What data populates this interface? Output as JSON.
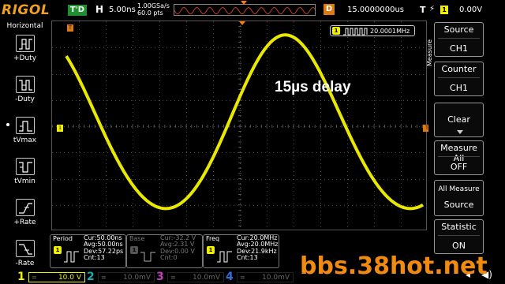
{
  "brand": {
    "logo": "RIGOL"
  },
  "topbar": {
    "trigger_status": "T'D",
    "horizontal_label": "H",
    "timebase": "5.00ns",
    "sample_rate": "1.00GSa/s",
    "memory_depth": "60.0 pts",
    "delay_label": "D",
    "delay_value": "15.0000000us",
    "trigger_label": "T",
    "trigger_edge": "⚡",
    "trigger_channel": "1",
    "trigger_level": "0.00V"
  },
  "left_panel": {
    "title": "Horizontal",
    "items": [
      {
        "label": "+Duty",
        "icon": "positive-duty-icon"
      },
      {
        "label": "-Duty",
        "icon": "negative-duty-icon"
      },
      {
        "label": "tVmax",
        "icon": "tvmax-icon"
      },
      {
        "label": "tVmin",
        "icon": "tvmin-icon"
      },
      {
        "label": "+Rate",
        "icon": "positive-rate-icon"
      },
      {
        "label": "-Rate",
        "icon": "negative-rate-icon"
      }
    ]
  },
  "screen": {
    "annotation": "15µs delay",
    "frequency_readout": {
      "channel": "1",
      "value": "20.0001MHz"
    },
    "markers": {
      "trigger_position": "T",
      "channel1_ground": "1",
      "trigger_level": "T"
    },
    "waveform_color": "#e8e800"
  },
  "right_menu": {
    "vertical_title": "Measure",
    "items": [
      {
        "label": "Source",
        "value": "CH1"
      },
      {
        "label": "Counter",
        "value": "CH1"
      },
      {
        "label": "Clear",
        "value": ""
      },
      {
        "label": "Measure All",
        "value": "OFF"
      },
      {
        "label": "All Measure",
        "value": "Source"
      },
      {
        "label": "Statistic",
        "value": "ON"
      }
    ]
  },
  "measurements": [
    {
      "name": "Period",
      "channel": "1",
      "lines": [
        "Cur:50.00ns",
        "Avg:50.00ns",
        "Dev:57.22ps",
        "Cnt:13"
      ],
      "dim": false
    },
    {
      "name": "Base",
      "channel": "1",
      "lines": [
        "Cur:-32.2 V",
        "Avg:2.31 V",
        "Dev:0.00 V",
        "Cnt:0"
      ],
      "dim": true
    },
    {
      "name": "Freq",
      "channel": "1",
      "lines": [
        "Cur:20.0MHz",
        "Avg:20.0MHz",
        "Dev:21.9kHz",
        "Cnt:13"
      ],
      "dim": false
    }
  ],
  "channels": [
    {
      "number": "1",
      "coupling": "=",
      "scale": "10.0 V",
      "color": "#f0f000",
      "active": true
    },
    {
      "number": "2",
      "coupling": "=",
      "scale": "10.0mV",
      "color": "#10b0b0",
      "active": false
    },
    {
      "number": "3",
      "coupling": "=",
      "scale": "10.0mV",
      "color": "#c040c0",
      "active": false
    },
    {
      "number": "4",
      "coupling": "=",
      "scale": "10.0mV",
      "color": "#3070e0",
      "active": false
    }
  ],
  "watermark": "bbs.38hot.net"
}
